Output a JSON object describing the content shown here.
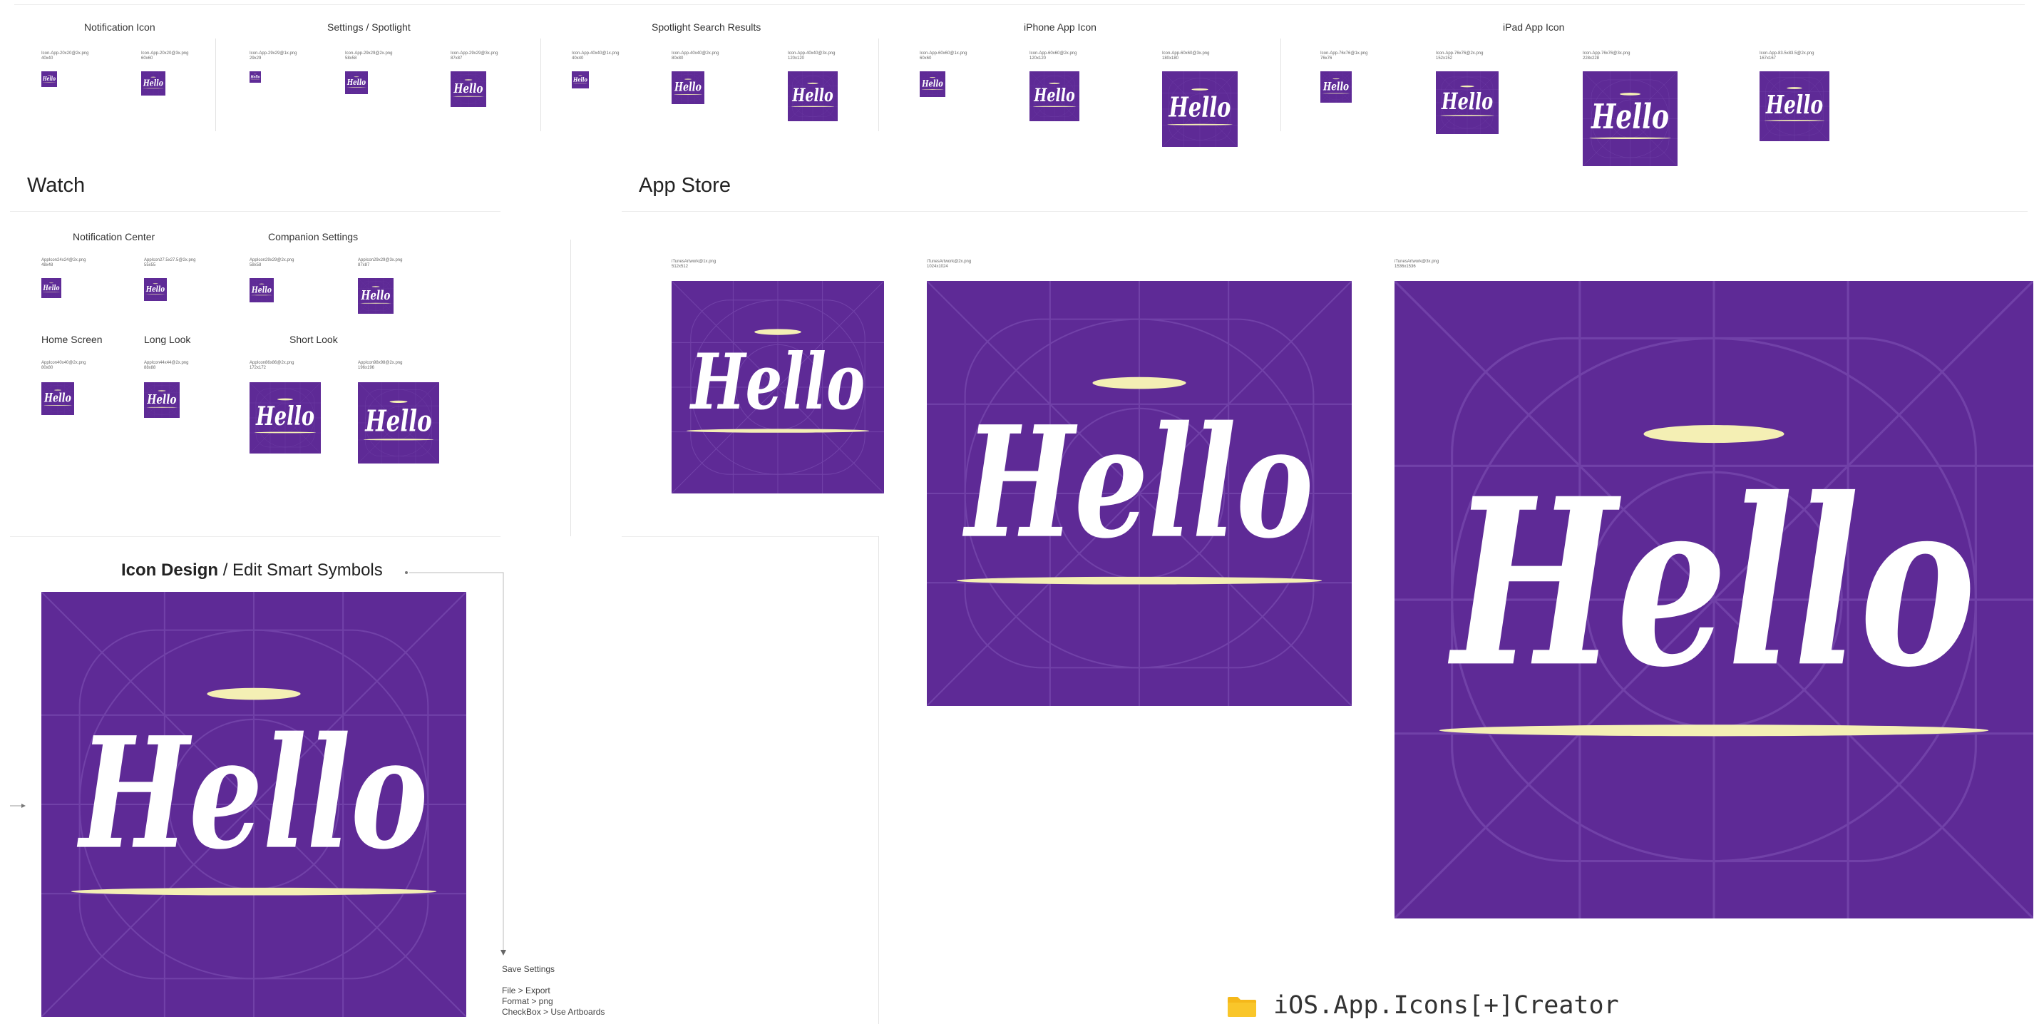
{
  "colors": {
    "icon_bg": "#5e2a96",
    "hello": "#ffffff",
    "accent_line": "#f4efb4",
    "grid": "#7a4cb0"
  },
  "icon_text": "Hello",
  "sections": {
    "notification": {
      "title": "Notification Icon",
      "labels": [
        "Icon-App-20x20@2x.png\n40x40",
        "Icon-App-20x20@3x.png\n60x60"
      ]
    },
    "settings": {
      "title": "Settings / Spotlight",
      "labels": [
        "Icon-App-29x29@1x.png\n29x29",
        "Icon-App-29x29@2x.png\n58x58",
        "Icon-App-29x29@3x.png\n87x87"
      ]
    },
    "spotlight": {
      "title": "Spotlight Search Results",
      "labels": [
        "Icon-App-40x40@1x.png\n40x40",
        "Icon-App-40x40@2x.png\n80x80",
        "Icon-App-40x40@3x.png\n120x120"
      ]
    },
    "iphone": {
      "title": "iPhone App Icon",
      "labels": [
        "Icon-App-60x60@1x.png\n60x60",
        "Icon-App-60x60@2x.png\n120x120",
        "Icon-App-60x60@3x.png\n180x180"
      ]
    },
    "ipad": {
      "title": "iPad App Icon",
      "labels": [
        "Icon-App-76x76@1x.png\n76x76",
        "Icon-App-76x76@2x.png\n152x152",
        "Icon-App-76x76@3x.png\n228x228",
        "Icon-App-83.5x83.5@2x.png\n167x167"
      ]
    }
  },
  "watch": {
    "title": "Watch",
    "notification_center": {
      "title": "Notification Center",
      "labels": [
        "AppIcon24x24@2x.png\n48x48",
        "AppIcon27.5x27.5@2x.png\n55x55"
      ]
    },
    "companion_settings": {
      "title": "Companion Settings",
      "labels": [
        "AppIcon29x29@2x.png\n58x58",
        "AppIcon29x29@3x.png\n87x87"
      ]
    },
    "home_screen": {
      "title": "Home Screen",
      "labels": [
        "AppIcon40x40@2x.png\n80x80"
      ]
    },
    "long_look": {
      "title": "Long Look",
      "labels": [
        "AppIcon44x44@2x.png\n88x88"
      ]
    },
    "short_look": {
      "title": "Short Look",
      "labels": [
        "AppIcon86x86@2x.png\n172x172",
        "AppIcon98x98@2x.png\n196x196"
      ]
    }
  },
  "app_store": {
    "title": "App Store",
    "labels": [
      "iTunesArtwork@1x.png\n512x512",
      "iTunesArtwork@2x.png\n1024x1024",
      "iTunesArtwork@3x.png\n1536x1536"
    ]
  },
  "icon_design": {
    "title_bold": "Icon Design",
    "title_rest": " / Edit Smart Symbols"
  },
  "save_settings": {
    "title": "Save Settings",
    "lines": [
      "File > Export",
      "Format > png",
      "CheckBox > Use Artboards"
    ]
  },
  "project": {
    "name": "iOS.App.Icons[+]Creator",
    "icon": "folder-icon"
  }
}
